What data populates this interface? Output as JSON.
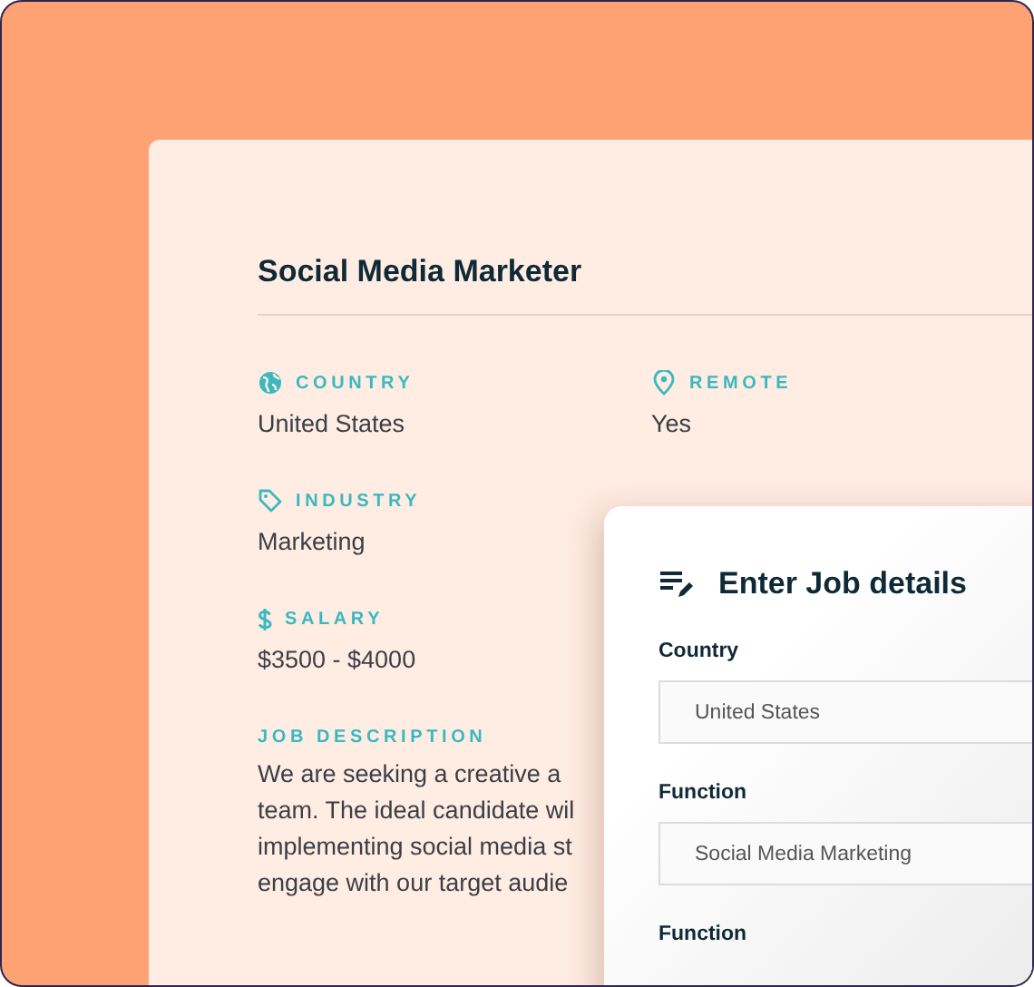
{
  "job": {
    "title": "Social Media Marketer",
    "fields": [
      {
        "kind": "globe",
        "label": "COUNTRY",
        "value": "United States"
      },
      {
        "kind": "pin",
        "label": "REMOTE",
        "value": "Yes"
      },
      {
        "kind": "tag",
        "label": "INDUSTRY",
        "value": "Marketing"
      },
      {
        "kind": "dollar",
        "label": "SALARY",
        "value": "$3500 - $4000"
      }
    ],
    "description": {
      "label": "JOB DESCRIPTION",
      "lines": [
        "We are seeking a creative a",
        "team. The ideal candidate wil",
        "implementing social media st",
        "engage with our target audie"
      ]
    }
  },
  "form": {
    "title": "Enter Job details",
    "fields": [
      {
        "label": "Country",
        "value": "United States"
      },
      {
        "label": "Function",
        "value": "Social Media Marketing"
      },
      {
        "label": "Function"
      }
    ]
  }
}
